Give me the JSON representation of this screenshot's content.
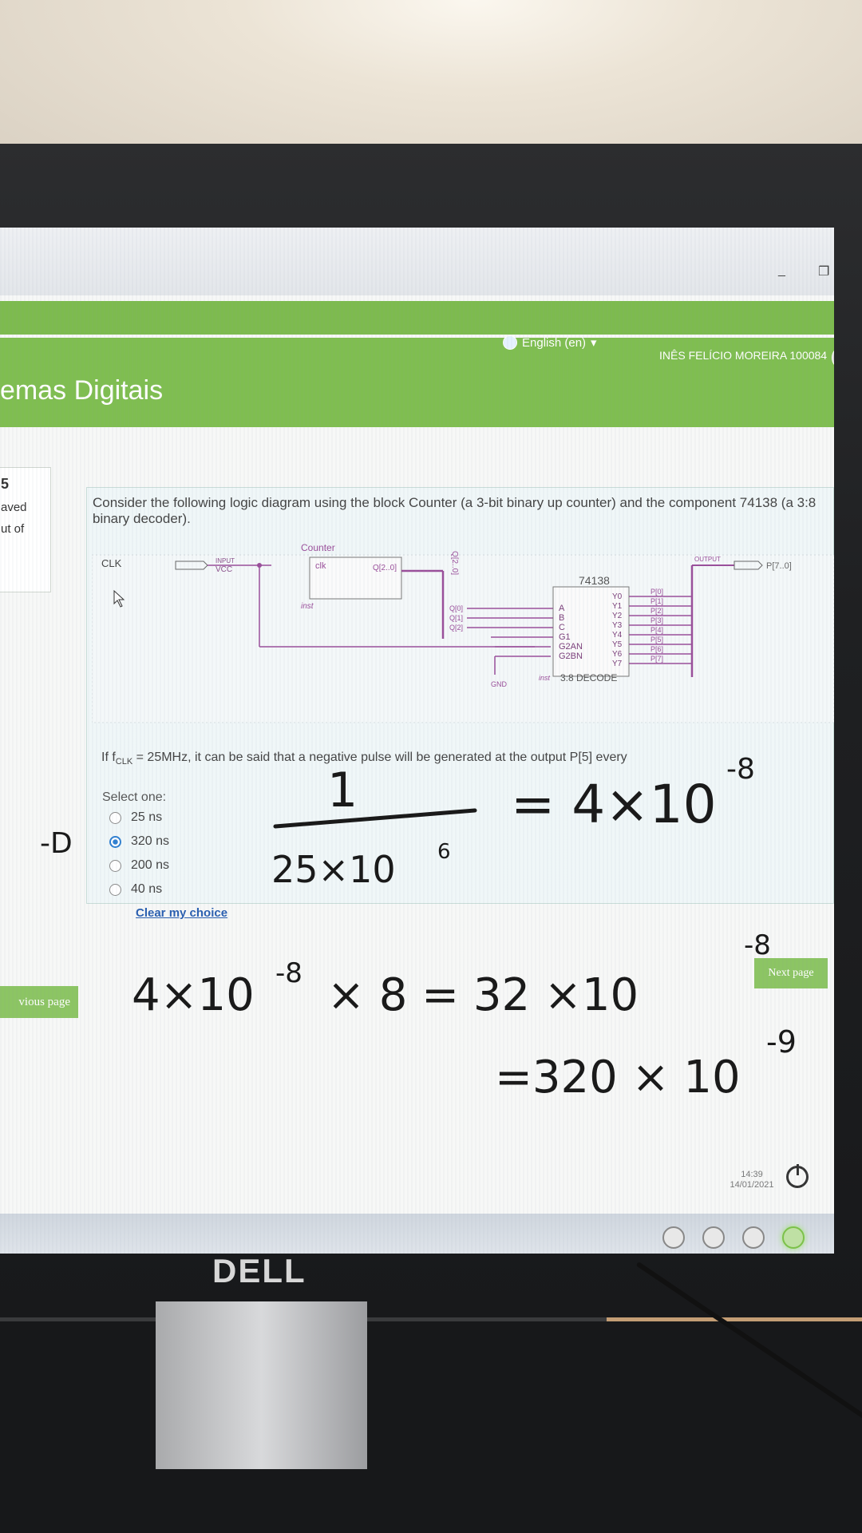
{
  "browser": {
    "window_buttons": [
      "_",
      "❐"
    ]
  },
  "header": {
    "language": "English (en)",
    "user_name": "INÊS FELÍCIO MOREIRA 100084",
    "course_title": "emas Digitais"
  },
  "question_info": {
    "number": "5",
    "status": "aved",
    "marks": "ut of"
  },
  "question": {
    "text": "Consider the following logic diagram using the block Counter (a 3-bit binary up counter) and the component 74138 (a 3:8 binary decoder).",
    "prompt_pre": "If f",
    "prompt_sub": "CLK",
    "prompt_post": " = 25MHz, it can be said that a negative pulse will be generated at the output P[5] every",
    "select_one": "Select one:",
    "options": [
      {
        "label": "25 ns",
        "selected": false
      },
      {
        "label": "320 ns",
        "selected": true
      },
      {
        "label": "200 ns",
        "selected": false
      },
      {
        "label": "40 ns",
        "selected": false
      }
    ],
    "clear_choice": "Clear my choice"
  },
  "diagram": {
    "clk": "CLK",
    "input_tag": "INPUT",
    "vcc": "VCC",
    "counter_title": "Counter",
    "counter_in": "clk",
    "counter_out": "Q[2..0]",
    "counter_inst": "inst",
    "bus_label": "Q[2..0]",
    "taps": [
      "Q[0]",
      "Q[1]",
      "Q[2]"
    ],
    "decoder_title": "74138",
    "decoder_inputs": [
      "A",
      "B",
      "C",
      "G1",
      "G2AN",
      "G2BN"
    ],
    "decoder_outputs": [
      "Y0",
      "Y1",
      "Y2",
      "Y3",
      "Y4",
      "Y5",
      "Y6",
      "Y7"
    ],
    "p_labels": [
      "P[0]",
      "P[1]",
      "P[2]",
      "P[3]",
      "P[4]",
      "P[5]",
      "P[6]",
      "P[7]"
    ],
    "gnd": "GND",
    "decoder_inst": "inst",
    "decoder_caption": "3:8 DECODE",
    "output_tag": "OUTPUT",
    "output_bus": "P[7..0]"
  },
  "navigation": {
    "previous": "vious page",
    "next": "Next page"
  },
  "taskbar": {
    "time": "14:39",
    "date": "14/01/2021"
  },
  "handwriting": {
    "arrow": "-D",
    "numerator": "1",
    "denominator": "25×10",
    "denom_exp": "6",
    "result1": "= 4×10",
    "result1_exp": "-8",
    "line2": "4×10",
    "line2_exp": "-8",
    "line2_rest": "× 8 = 32 ×10",
    "line2_exp2": "-8",
    "line3": "=320 × 10",
    "line3_exp": "-9"
  },
  "monitor_brand": "DELL"
}
